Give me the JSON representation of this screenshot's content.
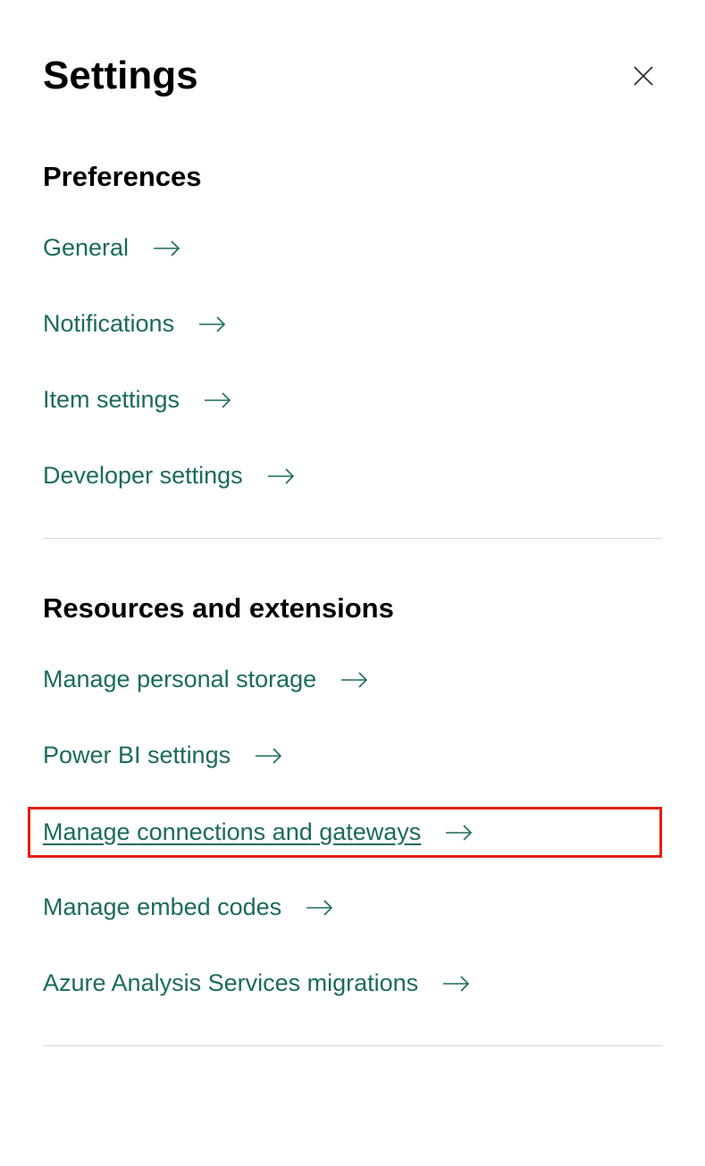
{
  "header": {
    "title": "Settings"
  },
  "sections": {
    "preferences": {
      "title": "Preferences",
      "items": [
        {
          "label": "General"
        },
        {
          "label": "Notifications"
        },
        {
          "label": "Item settings"
        },
        {
          "label": "Developer settings"
        }
      ]
    },
    "resources": {
      "title": "Resources and extensions",
      "items": [
        {
          "label": "Manage personal storage"
        },
        {
          "label": "Power BI settings"
        },
        {
          "label": "Manage connections and gateways"
        },
        {
          "label": "Manage embed codes"
        },
        {
          "label": "Azure Analysis Services migrations"
        }
      ]
    }
  }
}
